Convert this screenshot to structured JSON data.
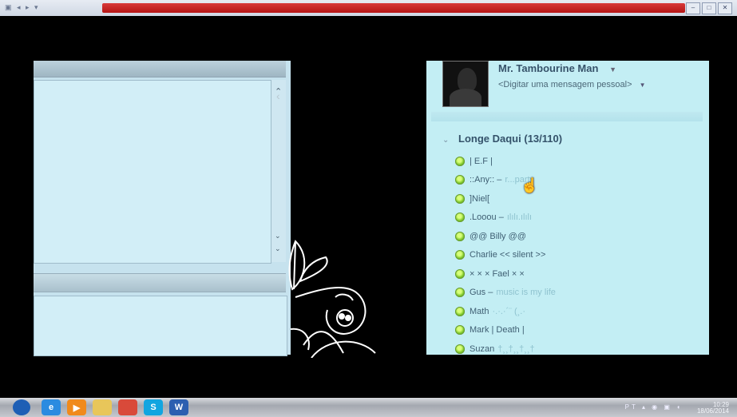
{
  "window": {
    "title": "",
    "controls": [
      "–",
      "□",
      "✕"
    ]
  },
  "messenger": {
    "user_name": "Mr. Tambourine Man",
    "personal_message_placeholder": "<Digitar uma mensagem pessoal>",
    "group": {
      "name": "Longe Daqui",
      "count": "(13/110)"
    },
    "contacts": [
      {
        "name": "| E.F |",
        "message": ""
      },
      {
        "name": "::Any:: –",
        "message": "r...party"
      },
      {
        "name": "]Niel[",
        "message": ""
      },
      {
        "name": ".Looou –",
        "message": "ılılı.ılılı"
      },
      {
        "name": "@@ Billy @@",
        "message": ""
      },
      {
        "name": "Charlie << silent >>",
        "message": ""
      },
      {
        "name": "× × ×  Fael × ×",
        "message": ""
      },
      {
        "name": "Gus –",
        "message": "music is my life"
      },
      {
        "name": "Math",
        "message": "·.·.·´¨ (¸.·"
      },
      {
        "name": "Mark | Death |",
        "message": ""
      },
      {
        "name": "Suzan",
        "message": "†¸¸†¸¸†¸¸†"
      }
    ]
  },
  "taskbar": {
    "apps": [
      {
        "icon": "windows-start-icon",
        "label": "",
        "color": "#1e5fb5"
      },
      {
        "icon": "ie-icon",
        "label": "e",
        "color": "#2b8be0"
      },
      {
        "icon": "media-player-icon",
        "label": "▶",
        "color": "#f08a1c"
      },
      {
        "icon": "folder-icon",
        "label": "",
        "color": "#e8c65a"
      },
      {
        "icon": "chrome-icon",
        "label": "",
        "color": "#d94a3a"
      },
      {
        "icon": "skype-icon",
        "label": "S",
        "color": "#12a5e0"
      },
      {
        "icon": "word-icon",
        "label": "W",
        "color": "#2c5fb0"
      }
    ],
    "lang": "PT",
    "time": "10:29",
    "date": "18/06/2014"
  }
}
